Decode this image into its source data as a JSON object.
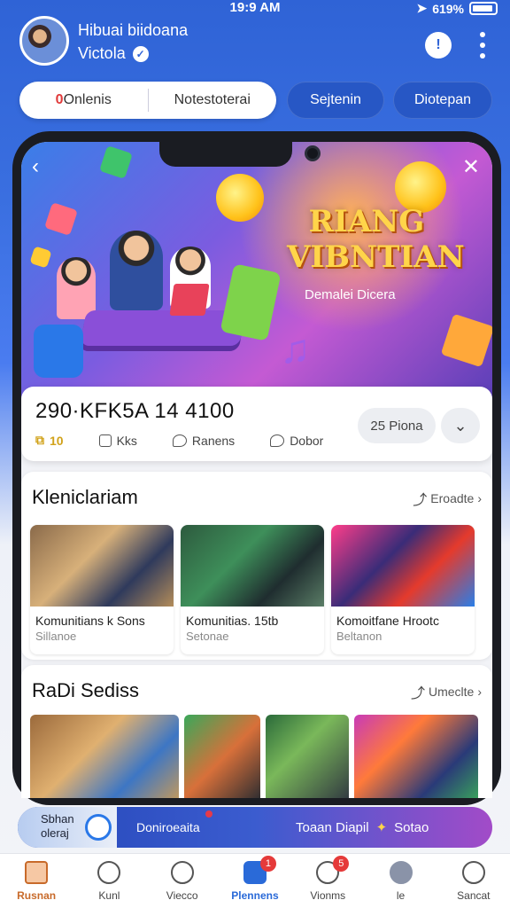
{
  "status": {
    "time": "19:9 AM",
    "battery": "619%"
  },
  "profile": {
    "name": "Hibuai biidoana",
    "sub": "Victola"
  },
  "tabs": [
    {
      "label": "Onlenis",
      "prefix": "0"
    },
    {
      "label": "Notestoterai"
    }
  ],
  "pills": [
    "Sejtenin",
    "Diotepan"
  ],
  "banner": {
    "title": "RIANG VIBNTIAN",
    "subtitle": "Demalei Dicera"
  },
  "info": {
    "title": "290·KFK5A 14 4100",
    "stats": [
      "10",
      "Kks",
      "Ranens",
      "Dobor"
    ],
    "button": "25 Piona"
  },
  "section1": {
    "title": "Kleniclariam",
    "more": "Eroadte",
    "cards": [
      {
        "title": "Komunitians k Sons",
        "sub": "Sillanoe"
      },
      {
        "title": "Komunitias. 15tb",
        "sub": "Setonae"
      },
      {
        "title": "Komoitfane Hrootc",
        "sub": "Beltanon"
      }
    ]
  },
  "section2": {
    "title": "RaDi Sediss",
    "more": "Umeclte"
  },
  "promo": {
    "left_line1": "Sbhan",
    "left_line2": "oleraj",
    "center": "Doniroeaita",
    "right": "Toaan Diapil",
    "right2": "Sotao"
  },
  "tabbar": [
    {
      "label": "Rusnan"
    },
    {
      "label": "Kunl"
    },
    {
      "label": "Viecco"
    },
    {
      "label": "Plennens",
      "badge": "1"
    },
    {
      "label": "Vionms",
      "badge": "5"
    },
    {
      "label": "le"
    },
    {
      "label": "Sancat"
    }
  ]
}
